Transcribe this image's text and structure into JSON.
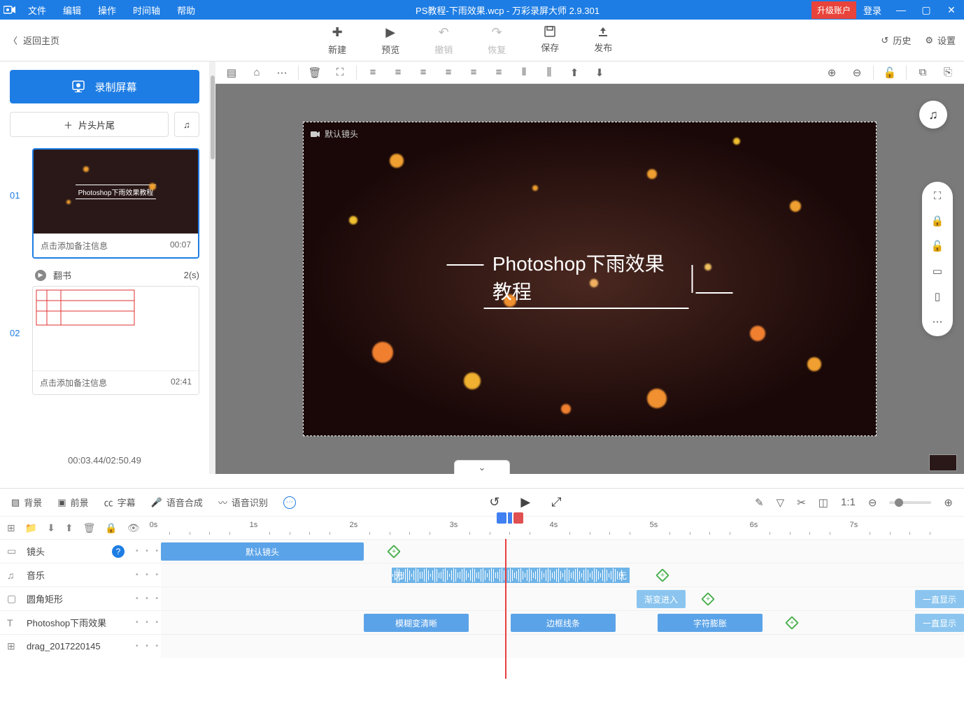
{
  "titlebar": {
    "menus": [
      "文件",
      "编辑",
      "操作",
      "时间轴",
      "帮助"
    ],
    "title": "PS教程-下雨效果.wcp - 万彩录屏大师 2.9.301",
    "upgrade": "升级账户",
    "login": "登录"
  },
  "toolbar": {
    "back": "返回主页",
    "buttons": [
      {
        "label": "新建",
        "icon": "＋"
      },
      {
        "label": "预览",
        "icon": "▶"
      },
      {
        "label": "撤销",
        "icon": "↶",
        "disabled": true
      },
      {
        "label": "恢复",
        "icon": "↷",
        "disabled": true
      },
      {
        "label": "保存",
        "icon": "💾"
      },
      {
        "label": "发布",
        "icon": "⬆"
      }
    ],
    "history": "历史",
    "settings": "设置"
  },
  "sidebar": {
    "record": "录制屏幕",
    "head_tail": "片头片尾",
    "thumbs": [
      {
        "num": "01",
        "note": "点击添加备注信息",
        "time": "00:07",
        "preview_text": "Photoshop下雨效果教程",
        "selected": true
      },
      {
        "num": "02",
        "note": "点击添加备注信息",
        "time": "02:41",
        "white": true
      }
    ],
    "transition": {
      "name": "翻书",
      "duration": "2(s)"
    },
    "timestamp": "00:03.44/02:50.49"
  },
  "canvas": {
    "cam_label": "默认镜头",
    "video_title": "Photoshop下雨效果教程"
  },
  "lower_tabs": {
    "items": [
      {
        "label": "背景"
      },
      {
        "label": "前景"
      },
      {
        "label": "字幕"
      },
      {
        "label": "语音合成"
      },
      {
        "label": "语音识别"
      }
    ]
  },
  "timeline": {
    "marks": [
      "0s",
      "1s",
      "2s",
      "3s",
      "4s",
      "5s",
      "6s",
      "7s"
    ],
    "tracks": [
      {
        "icon": "📹",
        "name": "镜头",
        "help": true
      },
      {
        "icon": "♫",
        "name": "音乐"
      },
      {
        "icon": "▢",
        "name": "圆角矩形"
      },
      {
        "icon": "T",
        "name": "Photoshop下雨效果"
      },
      {
        "icon": "⊞",
        "name": "drag_2017220145"
      }
    ],
    "clips": {
      "shot": {
        "label": "默认镜头"
      },
      "audio_caps": {
        "start": "无",
        "end": "无"
      },
      "rect": {
        "in": "渐变进入",
        "hold": "一直显示"
      },
      "text": {
        "a": "模糊变清晰",
        "b": "边框线条",
        "c": "字符膨胀",
        "hold": "一直显示"
      }
    }
  }
}
